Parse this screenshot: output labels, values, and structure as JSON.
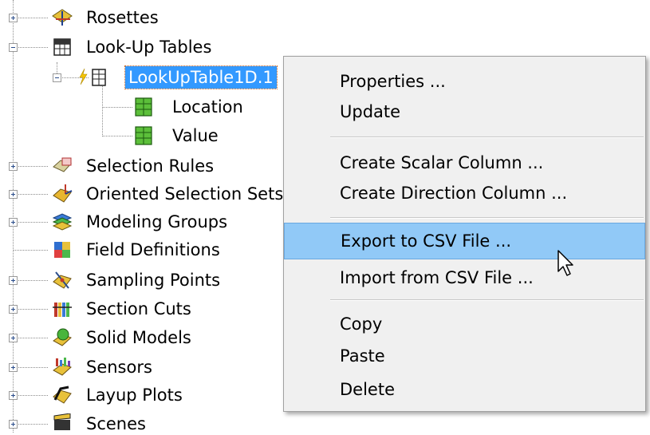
{
  "tree": {
    "items": [
      {
        "label": "Rosettes"
      },
      {
        "label": "Look-Up Tables"
      },
      {
        "label": "LookUpTable1D.1"
      },
      {
        "label": "Location"
      },
      {
        "label": "Value"
      },
      {
        "label": "Selection Rules"
      },
      {
        "label": "Oriented Selection Sets"
      },
      {
        "label": "Modeling Groups"
      },
      {
        "label": "Field Definitions"
      },
      {
        "label": "Sampling Points"
      },
      {
        "label": "Section Cuts"
      },
      {
        "label": "Solid Models"
      },
      {
        "label": "Sensors"
      },
      {
        "label": "Layup Plots"
      },
      {
        "label": "Scenes"
      }
    ]
  },
  "context_menu": {
    "items": [
      {
        "label": "Properties ..."
      },
      {
        "label": "Update"
      },
      {
        "label": "Create Scalar Column ..."
      },
      {
        "label": "Create Direction Column ..."
      },
      {
        "label": "Export to CSV File ..."
      },
      {
        "label": "Import from CSV File ..."
      },
      {
        "label": "Copy"
      },
      {
        "label": "Paste"
      },
      {
        "label": "Delete"
      }
    ],
    "highlighted": "Export to CSV File ..."
  },
  "colors": {
    "selection": "#3399ff",
    "menu_highlight": "#91c9f7",
    "menu_background": "#f0f0f0"
  }
}
